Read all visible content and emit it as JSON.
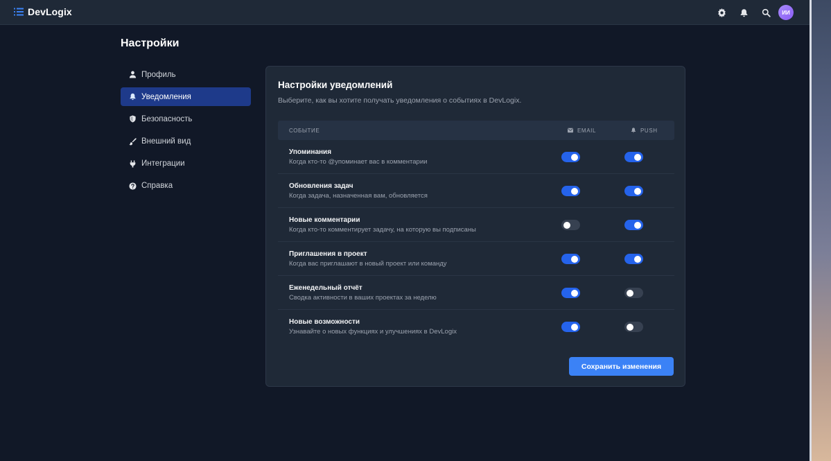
{
  "app": {
    "name": "DevLogix",
    "user_initials": "ИИ"
  },
  "colors": {
    "accent": "#3b82f6",
    "toggle_on": "#2563eb",
    "active_nav": "#1e3a8a",
    "background": "#111827",
    "surface": "#1f2937"
  },
  "header": {
    "icons": [
      "gear-icon",
      "bell-icon",
      "search-icon"
    ]
  },
  "page": {
    "title": "Настройки"
  },
  "sidebar": {
    "items": [
      {
        "label": "Профиль",
        "icon": "user-icon",
        "active": false
      },
      {
        "label": "Уведомления",
        "icon": "bell-icon",
        "active": true
      },
      {
        "label": "Безопасность",
        "icon": "shield-icon",
        "active": false
      },
      {
        "label": "Внешний вид",
        "icon": "brush-icon",
        "active": false
      },
      {
        "label": "Интеграции",
        "icon": "plug-icon",
        "active": false
      },
      {
        "label": "Справка",
        "icon": "help-icon",
        "active": false
      }
    ]
  },
  "notifications": {
    "title": "Настройки уведомлений",
    "description": "Выберите, как вы хотите получать уведомления о событиях в DevLogix.",
    "columns": {
      "event": "СОБЫТИЕ",
      "email": "EMAIL",
      "push": "PUSH"
    },
    "rows": [
      {
        "title": "Упоминания",
        "description": "Когда кто-то @упоминает вас в комментарии",
        "email": true,
        "push": true
      },
      {
        "title": "Обновления задач",
        "description": "Когда задача, назначенная вам, обновляется",
        "email": true,
        "push": true
      },
      {
        "title": "Новые комментарии",
        "description": "Когда кто-то комментирует задачу, на которую вы подписаны",
        "email": false,
        "push": true
      },
      {
        "title": "Приглашения в проект",
        "description": "Когда вас приглашают в новый проект или команду",
        "email": true,
        "push": true
      },
      {
        "title": "Еженедельный отчёт",
        "description": "Сводка активности в ваших проектах за неделю",
        "email": true,
        "push": false
      },
      {
        "title": "Новые возможности",
        "description": "Узнавайте о новых функциях и улучшениях в DevLogix",
        "email": true,
        "push": false
      }
    ],
    "save_label": "Сохранить изменения"
  }
}
